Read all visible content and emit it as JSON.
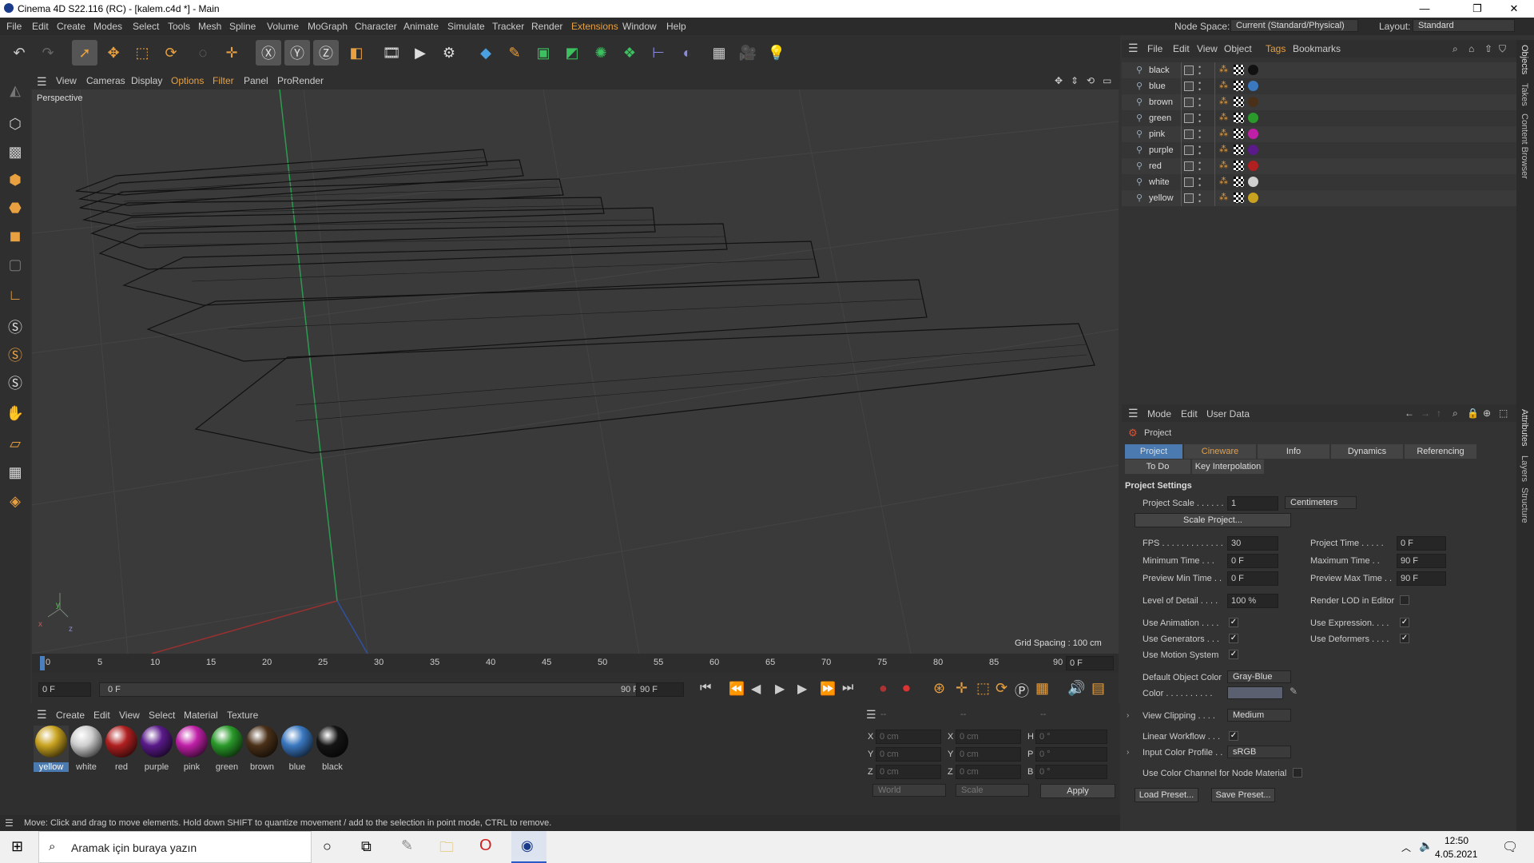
{
  "window": {
    "title": "Cinema 4D S22.116 (RC) - [kalem.c4d *] - Main"
  },
  "menu": {
    "items": [
      "File",
      "Edit",
      "Create",
      "Modes",
      "Select",
      "Tools",
      "Mesh",
      "Spline",
      "Volume",
      "MoGraph",
      "Character",
      "Animate",
      "Simulate",
      "Tracker",
      "Render",
      "Extensions",
      "Window",
      "Help"
    ],
    "node_space_label": "Node Space:",
    "node_space_value": "Current (Standard/Physical)",
    "layout_label": "Layout:",
    "layout_value": "Standard"
  },
  "viewport": {
    "menu": [
      "View",
      "Cameras",
      "Display",
      "Options",
      "Filter",
      "Panel",
      "ProRender"
    ],
    "camera": "Perspective",
    "grid_spacing": "Grid Spacing : 100 cm",
    "axes": {
      "x": "x",
      "y": "y",
      "z": "z"
    }
  },
  "timeline": {
    "ticks": [
      "0",
      "5",
      "10",
      "15",
      "20",
      "25",
      "30",
      "35",
      "40",
      "45",
      "50",
      "55",
      "60",
      "65",
      "70",
      "75",
      "80",
      "85",
      "90"
    ],
    "current_frame": "0 F"
  },
  "transport": {
    "start": "0 F",
    "min": "0 F",
    "max": "90 F",
    "end": "90 F"
  },
  "materials": {
    "menu": [
      "Create",
      "Edit",
      "View",
      "Select",
      "Material",
      "Texture"
    ],
    "items": [
      {
        "name": "yellow",
        "color": "#c9a320"
      },
      {
        "name": "white",
        "color": "#cfcfcf"
      },
      {
        "name": "red",
        "color": "#b02020"
      },
      {
        "name": "purple",
        "color": "#5a1a8a"
      },
      {
        "name": "pink",
        "color": "#c020a8"
      },
      {
        "name": "green",
        "color": "#2a9a2a"
      },
      {
        "name": "brown",
        "color": "#4a3018"
      },
      {
        "name": "blue",
        "color": "#3a78c0"
      },
      {
        "name": "black",
        "color": "#151515"
      }
    ]
  },
  "coords": {
    "header": [
      "--",
      "--",
      "--"
    ],
    "rows": [
      {
        "a": "X",
        "av": "0 cm",
        "b": "X",
        "bv": "0 cm",
        "c": "H",
        "cv": "0 °"
      },
      {
        "a": "Y",
        "av": "0 cm",
        "b": "Y",
        "bv": "0 cm",
        "c": "P",
        "cv": "0 °"
      },
      {
        "a": "Z",
        "av": "0 cm",
        "b": "Z",
        "bv": "0 cm",
        "c": "B",
        "cv": "0 °"
      }
    ],
    "world": "World",
    "scale": "Scale",
    "apply": "Apply"
  },
  "status": "Move: Click and drag to move elements. Hold down SHIFT to quantize movement / add to the selection in point mode, CTRL to remove.",
  "objects": {
    "menu": [
      "File",
      "Edit",
      "View",
      "Object",
      "Tags",
      "Bookmarks"
    ],
    "items": [
      {
        "name": "black",
        "color": "#111111"
      },
      {
        "name": "blue",
        "color": "#3a78c0"
      },
      {
        "name": "brown",
        "color": "#4a3018"
      },
      {
        "name": "green",
        "color": "#2a9a2a"
      },
      {
        "name": "pink",
        "color": "#c020a8"
      },
      {
        "name": "purple",
        "color": "#5a1a8a"
      },
      {
        "name": "red",
        "color": "#b02020"
      },
      {
        "name": "white",
        "color": "#cfcfcf"
      },
      {
        "name": "yellow",
        "color": "#c9a320"
      }
    ]
  },
  "attributes": {
    "menu": [
      "Mode",
      "Edit",
      "User Data"
    ],
    "object": "Project",
    "tabs": [
      "Project Settings",
      "Cineware",
      "Info",
      "Dynamics",
      "Referencing"
    ],
    "tabs2": [
      "To Do",
      "Key Interpolation"
    ],
    "section": "Project Settings",
    "project_scale_label": "Project Scale . . . . . .",
    "project_scale": "1",
    "units": "Centimeters",
    "scale_project": "Scale Project...",
    "fps_label": "FPS . . . . . . . . . . . . .",
    "fps": "30",
    "project_time_label": "Project Time . . . . .",
    "project_time": "0 F",
    "min_time_label": "Minimum Time . . .",
    "min_time": "0 F",
    "max_time_label": "Maximum Time . .",
    "max_time": "90 F",
    "prev_min_label": "Preview Min Time . .",
    "prev_min": "0 F",
    "prev_max_label": "Preview Max Time . .",
    "prev_max": "90 F",
    "lod_label": "Level of Detail . . . .",
    "lod": "100 %",
    "render_lod_label": "Render LOD in Editor",
    "use_anim": "Use Animation . . . .",
    "use_expr": "Use Expression. . . .",
    "use_gen": "Use Generators . . .",
    "use_def": "Use Deformers . . . .",
    "use_motion": "Use Motion System",
    "default_color_label": "Default Object Color",
    "default_color": "Gray-Blue",
    "color_label": "Color . . . . . . . . . .",
    "view_clipping_label": "View Clipping . . . .",
    "view_clipping": "Medium",
    "linear_wf": "Linear Workflow . . .",
    "input_profile_label": "Input Color Profile . .",
    "input_profile": "sRGB",
    "color_channel": "Use Color Channel for Node Material",
    "load_preset": "Load Preset...",
    "save_preset": "Save Preset..."
  },
  "right_strip": [
    "Objects",
    "Takes",
    "Content Browser",
    "Attributes",
    "Layers",
    "Structure"
  ],
  "taskbar": {
    "search_placeholder": "Aramak için buraya yazın",
    "time": "12:50",
    "date": "4.05.2021"
  }
}
